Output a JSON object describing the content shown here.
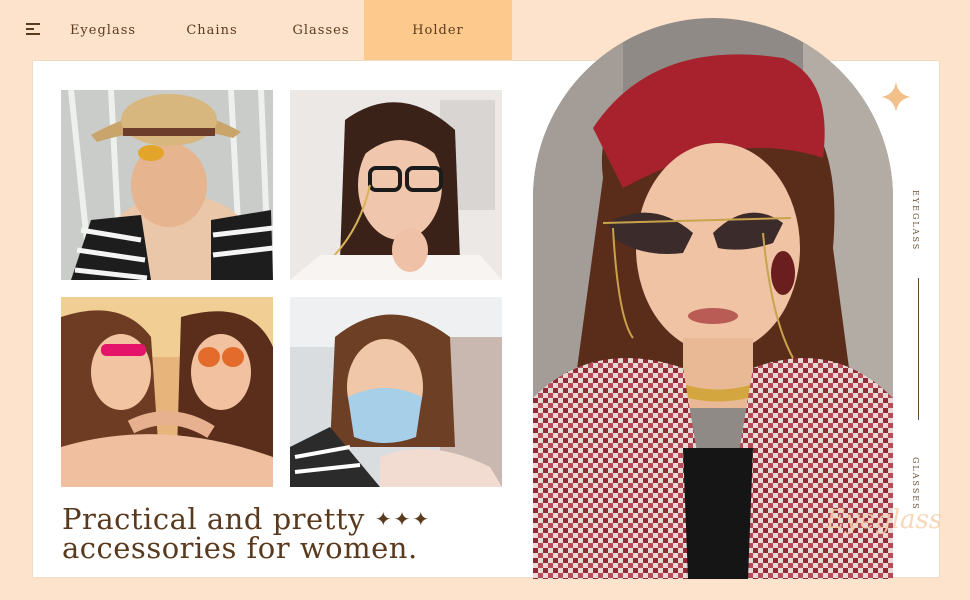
{
  "nav": {
    "items": [
      {
        "label": "Eyeglass",
        "active": false
      },
      {
        "label": "Chains",
        "active": false
      },
      {
        "label": "Glasses",
        "active": false
      },
      {
        "label": "Holder",
        "active": true
      }
    ]
  },
  "headline": {
    "line1": "Practical and pretty",
    "stars": "✦✦✦",
    "line2": "accessories for women."
  },
  "side_labels": {
    "top": "EYEGLASS",
    "bottom": "GLASSES"
  },
  "watermark": "Eyeglass",
  "colors": {
    "background": "#fde3cb",
    "active_tab": "#fdc98c",
    "text": "#5a3a1e",
    "accent": "#f2c089"
  },
  "icons": [
    "menu-icon",
    "sparkle-icon",
    "star-icon"
  ]
}
